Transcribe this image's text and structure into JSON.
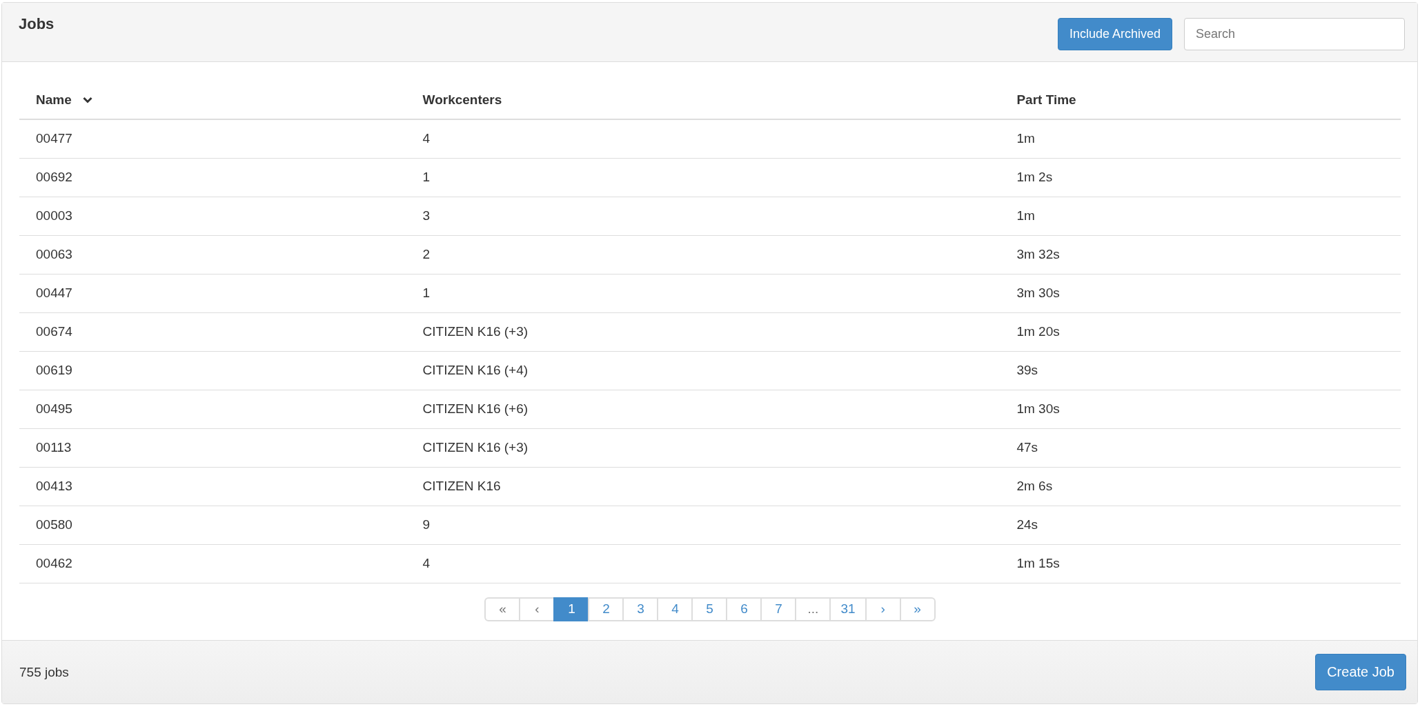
{
  "panel": {
    "title": "Jobs"
  },
  "toolbar": {
    "include_archived": {
      "label": "Include Archived"
    },
    "search": {
      "placeholder": "Search"
    }
  },
  "table": {
    "columns": [
      {
        "label": "Name",
        "sorted": true
      },
      {
        "label": "Workcenters",
        "sorted": false
      },
      {
        "label": "Part Time",
        "sorted": false
      }
    ],
    "rows": [
      [
        "00477",
        "4",
        "1m"
      ],
      [
        "00692",
        "1",
        "1m 2s"
      ],
      [
        "00003",
        "3",
        "1m"
      ],
      [
        "00063",
        "2",
        "3m 32s"
      ],
      [
        "00447",
        "1",
        "3m 30s"
      ],
      [
        "00674",
        "CITIZEN K16 (+3)",
        "1m 20s"
      ],
      [
        "00619",
        "CITIZEN K16 (+4)",
        "39s"
      ],
      [
        "00495",
        "CITIZEN K16 (+6)",
        "1m 30s"
      ],
      [
        "00113",
        "CITIZEN K16 (+3)",
        "47s"
      ],
      [
        "00413",
        "CITIZEN K16",
        "2m 6s"
      ],
      [
        "00580",
        "9",
        "24s"
      ],
      [
        "00462",
        "4",
        "1m 15s"
      ]
    ]
  },
  "pagination": [
    {
      "label": "«",
      "selected": false,
      "disabled": true
    },
    {
      "label": "‹",
      "selected": false,
      "disabled": true
    },
    {
      "label": "1",
      "selected": true,
      "disabled": false
    },
    {
      "label": "2",
      "selected": false,
      "disabled": false
    },
    {
      "label": "3",
      "selected": false,
      "disabled": false
    },
    {
      "label": "4",
      "selected": false,
      "disabled": false
    },
    {
      "label": "5",
      "selected": false,
      "disabled": false
    },
    {
      "label": "6",
      "selected": false,
      "disabled": false
    },
    {
      "label": "7",
      "selected": false,
      "disabled": false
    },
    {
      "label": "...",
      "selected": false,
      "disabled": true
    },
    {
      "label": "31",
      "selected": false,
      "disabled": false
    },
    {
      "label": "›",
      "selected": false,
      "disabled": false
    },
    {
      "label": "»",
      "selected": false,
      "disabled": false
    }
  ],
  "footer": {
    "count": "755 jobs",
    "create_button": "Create Job"
  }
}
